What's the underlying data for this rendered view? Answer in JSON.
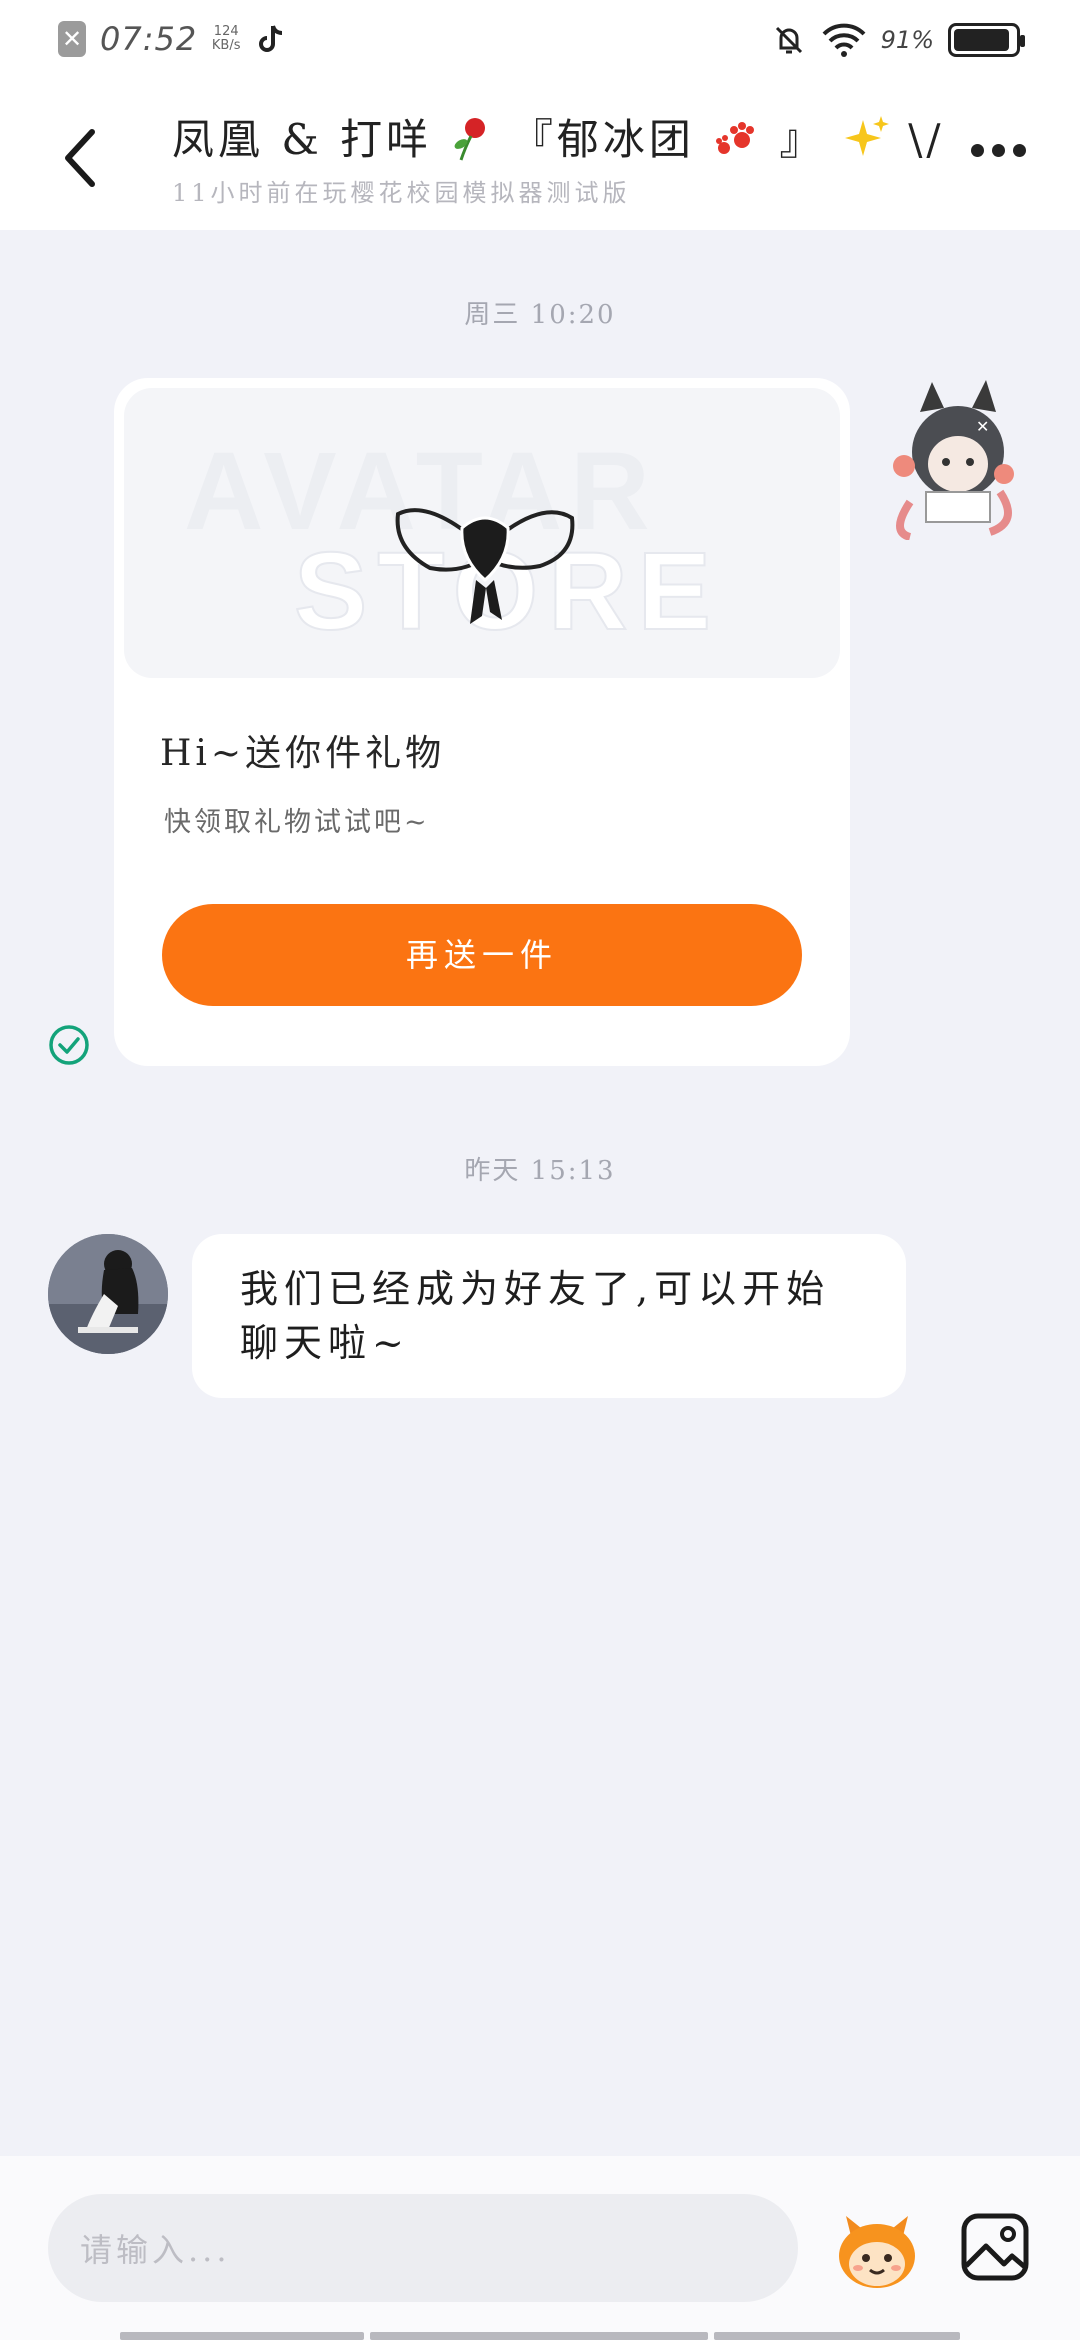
{
  "status_bar": {
    "time": "07:52",
    "net_speed_top": "124",
    "net_speed_bottom": "KB/s",
    "battery_percent": "91%",
    "battery_level": 0.91,
    "icons": [
      "close-icon",
      "tiktok-icon",
      "mute-icon",
      "wifi-icon",
      "battery-icon"
    ]
  },
  "header": {
    "title_text": "凤凰 & 打咩",
    "title_group": "『郁冰团",
    "title_end": "』",
    "title_suffix": "\\/",
    "subtitle": "11小时前在玩樱花校园模拟器测试版",
    "icons": [
      "back-icon",
      "rose-icon",
      "paw-icon",
      "sparkles-icon",
      "more-icon"
    ]
  },
  "chat": {
    "timestamps": [
      "周三 10:20",
      "昨天 15:13"
    ],
    "gift_card": {
      "banner_line1": "AVATAR",
      "banner_line2": "STORE",
      "title": "Hi~送你件礼物",
      "subtitle": "快领取礼物试试吧~",
      "button_label": "再送一件"
    },
    "friend_message": "我们已经成为好友了,可以开始聊天啦~"
  },
  "input_bar": {
    "placeholder": "请输入...",
    "icons": [
      "emoji-sticker-icon",
      "image-icon"
    ]
  },
  "colors": {
    "accent": "#fb7412",
    "background": "#f1f2f8",
    "read_check": "#13a37a"
  }
}
